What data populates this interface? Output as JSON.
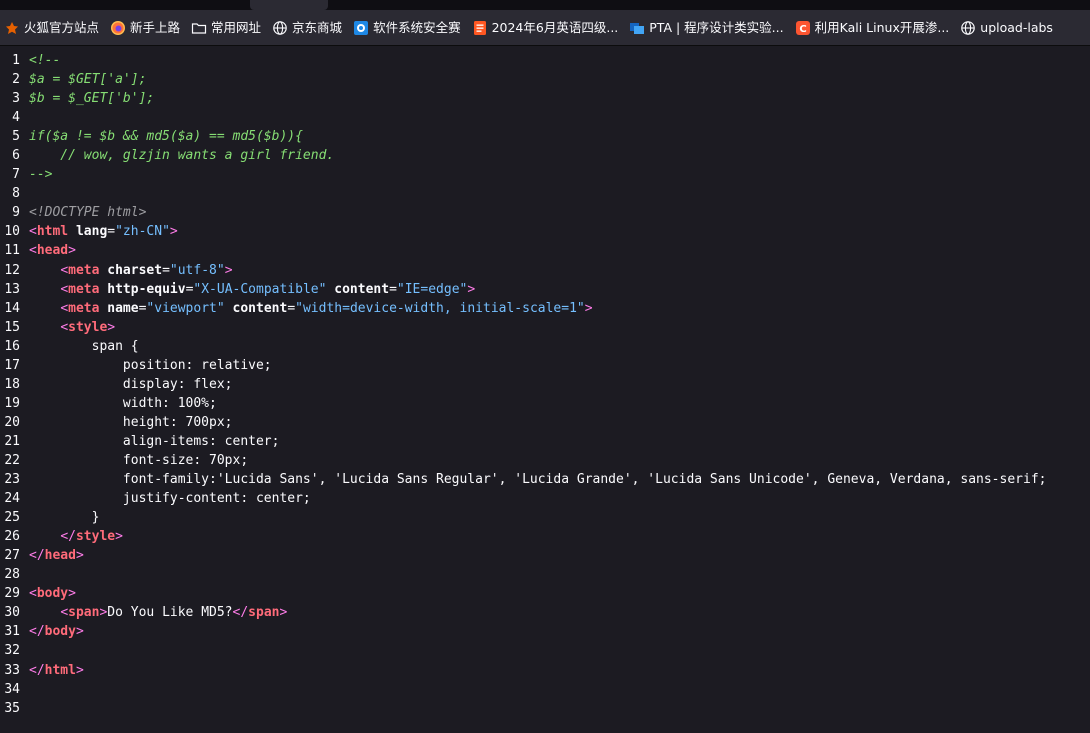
{
  "bookmarks": [
    {
      "label": "火狐官方站点",
      "icon": "firefox-bookmark-icon",
      "color": "#e66000"
    },
    {
      "label": "新手上路",
      "icon": "firefox-logo-icon",
      "color": "#ff7139"
    },
    {
      "label": "常用网址",
      "icon": "folder-icon",
      "color": "#fbfbfe"
    },
    {
      "label": "京东商城",
      "icon": "globe-icon",
      "color": "#fbfbfe"
    },
    {
      "label": "软件系统安全赛",
      "icon": "shield-site-icon",
      "color": "#1e88e5"
    },
    {
      "label": "2024年6月英语四级...",
      "icon": "document-site-icon",
      "color": "#ff5722"
    },
    {
      "label": "PTA | 程序设计类实验...",
      "icon": "pta-site-icon",
      "color": "#1565c0"
    },
    {
      "label": "利用Kali Linux开展渗...",
      "icon": "csdn-site-icon",
      "color": "#fc5531"
    },
    {
      "label": "upload-labs",
      "icon": "globe-icon",
      "color": "#fbfbfe"
    }
  ],
  "source": {
    "lines": [
      {
        "n": "1",
        "tokens": [
          {
            "t": "<!--",
            "c": "comment"
          }
        ]
      },
      {
        "n": "2",
        "tokens": [
          {
            "t": "$a = $GET['a'];",
            "c": "comment"
          }
        ]
      },
      {
        "n": "3",
        "tokens": [
          {
            "t": "$b = $_GET['b'];",
            "c": "comment"
          }
        ]
      },
      {
        "n": "4",
        "tokens": []
      },
      {
        "n": "5",
        "tokens": [
          {
            "t": "if($a != $b && md5($a) == md5($b)){",
            "c": "comment"
          }
        ]
      },
      {
        "n": "6",
        "tokens": [
          {
            "t": "    // wow, glzjin wants a girl friend.",
            "c": "comment"
          }
        ]
      },
      {
        "n": "7",
        "tokens": [
          {
            "t": "-->",
            "c": "comment"
          }
        ]
      },
      {
        "n": "8",
        "tokens": []
      },
      {
        "n": "9",
        "tokens": [
          {
            "t": "<!DOCTYPE html>",
            "c": "doctype"
          }
        ]
      },
      {
        "n": "10",
        "tokens": [
          {
            "t": "<",
            "c": "tag"
          },
          {
            "t": "html",
            "c": "tname"
          },
          {
            "t": " ",
            "c": "text"
          },
          {
            "t": "lang",
            "c": "aname"
          },
          {
            "t": "=",
            "c": "text"
          },
          {
            "t": "\"zh-CN\"",
            "c": "aval"
          },
          {
            "t": ">",
            "c": "tag"
          }
        ]
      },
      {
        "n": "11",
        "tokens": [
          {
            "t": "<",
            "c": "tag"
          },
          {
            "t": "head",
            "c": "tname"
          },
          {
            "t": ">",
            "c": "tag"
          }
        ]
      },
      {
        "n": "12",
        "tokens": [
          {
            "t": "    ",
            "c": "text"
          },
          {
            "t": "<",
            "c": "tag"
          },
          {
            "t": "meta",
            "c": "tname"
          },
          {
            "t": " ",
            "c": "text"
          },
          {
            "t": "charset",
            "c": "aname"
          },
          {
            "t": "=",
            "c": "text"
          },
          {
            "t": "\"utf-8\"",
            "c": "aval"
          },
          {
            "t": ">",
            "c": "tag"
          }
        ]
      },
      {
        "n": "13",
        "tokens": [
          {
            "t": "    ",
            "c": "text"
          },
          {
            "t": "<",
            "c": "tag"
          },
          {
            "t": "meta",
            "c": "tname"
          },
          {
            "t": " ",
            "c": "text"
          },
          {
            "t": "http-equiv",
            "c": "aname"
          },
          {
            "t": "=",
            "c": "text"
          },
          {
            "t": "\"X-UA-Compatible\"",
            "c": "aval"
          },
          {
            "t": " ",
            "c": "text"
          },
          {
            "t": "content",
            "c": "aname"
          },
          {
            "t": "=",
            "c": "text"
          },
          {
            "t": "\"IE=edge\"",
            "c": "aval"
          },
          {
            "t": ">",
            "c": "tag"
          }
        ]
      },
      {
        "n": "14",
        "tokens": [
          {
            "t": "    ",
            "c": "text"
          },
          {
            "t": "<",
            "c": "tag"
          },
          {
            "t": "meta",
            "c": "tname"
          },
          {
            "t": " ",
            "c": "text"
          },
          {
            "t": "name",
            "c": "aname"
          },
          {
            "t": "=",
            "c": "text"
          },
          {
            "t": "\"viewport\"",
            "c": "aval"
          },
          {
            "t": " ",
            "c": "text"
          },
          {
            "t": "content",
            "c": "aname"
          },
          {
            "t": "=",
            "c": "text"
          },
          {
            "t": "\"width=device-width, initial-scale=1\"",
            "c": "aval"
          },
          {
            "t": ">",
            "c": "tag"
          }
        ]
      },
      {
        "n": "15",
        "tokens": [
          {
            "t": "    ",
            "c": "text"
          },
          {
            "t": "<",
            "c": "tag"
          },
          {
            "t": "style",
            "c": "tname"
          },
          {
            "t": ">",
            "c": "tag"
          }
        ]
      },
      {
        "n": "16",
        "tokens": [
          {
            "t": "        span {",
            "c": "text"
          }
        ]
      },
      {
        "n": "17",
        "tokens": [
          {
            "t": "            position: relative;",
            "c": "text"
          }
        ]
      },
      {
        "n": "18",
        "tokens": [
          {
            "t": "            display: flex;",
            "c": "text"
          }
        ]
      },
      {
        "n": "19",
        "tokens": [
          {
            "t": "            width: 100%;",
            "c": "text"
          }
        ]
      },
      {
        "n": "20",
        "tokens": [
          {
            "t": "            height: 700px;",
            "c": "text"
          }
        ]
      },
      {
        "n": "21",
        "tokens": [
          {
            "t": "            align-items: center;",
            "c": "text"
          }
        ]
      },
      {
        "n": "22",
        "tokens": [
          {
            "t": "            font-size: 70px;",
            "c": "text"
          }
        ]
      },
      {
        "n": "23",
        "tokens": [
          {
            "t": "            font-family:'Lucida Sans', 'Lucida Sans Regular', 'Lucida Grande', 'Lucida Sans Unicode', Geneva, Verdana, sans-serif;",
            "c": "text"
          }
        ]
      },
      {
        "n": "24",
        "tokens": [
          {
            "t": "            justify-content: center;",
            "c": "text"
          }
        ]
      },
      {
        "n": "25",
        "tokens": [
          {
            "t": "        }",
            "c": "text"
          }
        ]
      },
      {
        "n": "26",
        "tokens": [
          {
            "t": "    ",
            "c": "text"
          },
          {
            "t": "</",
            "c": "tag"
          },
          {
            "t": "style",
            "c": "tname"
          },
          {
            "t": ">",
            "c": "tag"
          }
        ]
      },
      {
        "n": "27",
        "tokens": [
          {
            "t": "</",
            "c": "tag"
          },
          {
            "t": "head",
            "c": "tname"
          },
          {
            "t": ">",
            "c": "tag"
          }
        ]
      },
      {
        "n": "28",
        "tokens": []
      },
      {
        "n": "29",
        "tokens": [
          {
            "t": "<",
            "c": "tag"
          },
          {
            "t": "body",
            "c": "tname"
          },
          {
            "t": ">",
            "c": "tag"
          }
        ]
      },
      {
        "n": "30",
        "tokens": [
          {
            "t": "    ",
            "c": "text"
          },
          {
            "t": "<",
            "c": "tag"
          },
          {
            "t": "span",
            "c": "tname"
          },
          {
            "t": ">",
            "c": "tag"
          },
          {
            "t": "Do You Like MD5?",
            "c": "text"
          },
          {
            "t": "</",
            "c": "tag"
          },
          {
            "t": "span",
            "c": "tname"
          },
          {
            "t": ">",
            "c": "tag"
          }
        ]
      },
      {
        "n": "31",
        "tokens": [
          {
            "t": "</",
            "c": "tag"
          },
          {
            "t": "body",
            "c": "tname"
          },
          {
            "t": ">",
            "c": "tag"
          }
        ]
      },
      {
        "n": "32",
        "tokens": []
      },
      {
        "n": "33",
        "tokens": [
          {
            "t": "</",
            "c": "tag"
          },
          {
            "t": "html",
            "c": "tname"
          },
          {
            "t": ">",
            "c": "tag"
          }
        ]
      },
      {
        "n": "34",
        "tokens": []
      },
      {
        "n": "35",
        "tokens": []
      }
    ]
  }
}
